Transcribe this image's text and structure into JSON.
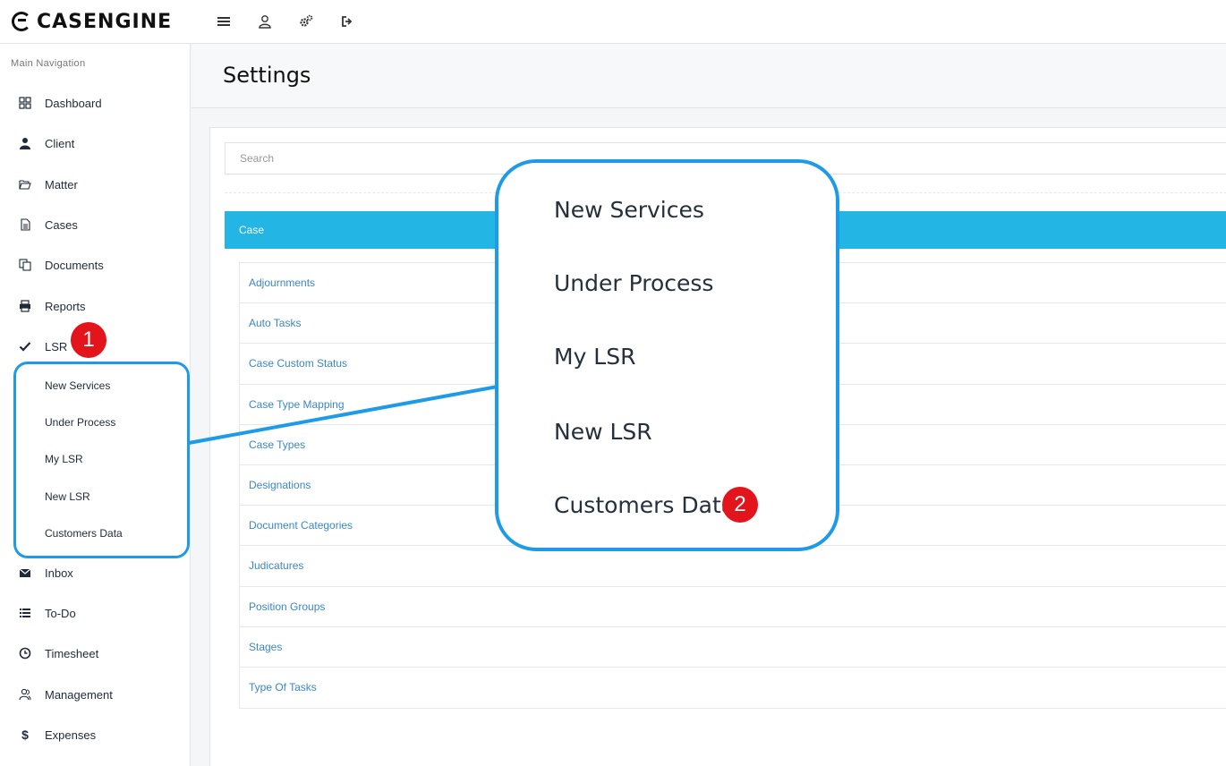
{
  "brand": {
    "name": "CASENGINE"
  },
  "topbar": {
    "icons": [
      {
        "name": "menu-icon"
      },
      {
        "name": "user-icon"
      },
      {
        "name": "settings-gears-icon"
      },
      {
        "name": "logout-icon"
      }
    ]
  },
  "sidebar": {
    "heading": "Main Navigation",
    "items": [
      {
        "label": "Dashboard",
        "icon": "grid-icon"
      },
      {
        "label": "Client",
        "icon": "person-icon"
      },
      {
        "label": "Matter",
        "icon": "folder-open-icon"
      },
      {
        "label": "Cases",
        "icon": "document-icon"
      },
      {
        "label": "Documents",
        "icon": "copy-icon"
      },
      {
        "label": "Reports",
        "icon": "printer-icon"
      },
      {
        "label": "LSR",
        "icon": "check-icon"
      },
      {
        "label": "Inbox",
        "icon": "envelope-icon"
      },
      {
        "label": "To-Do",
        "icon": "list-icon"
      },
      {
        "label": "Timesheet",
        "icon": "clock-icon"
      },
      {
        "label": "Management",
        "icon": "users-icon"
      },
      {
        "label": "Expenses",
        "icon": "dollar-icon"
      }
    ],
    "lsr_sub_items": [
      "New Services",
      "Under Process",
      "My LSR",
      "New LSR",
      "Customers Data"
    ]
  },
  "main": {
    "title": "Settings",
    "search_placeholder": "Search",
    "panel_title": "Case",
    "settings_links": [
      "Adjournments",
      "Auto Tasks",
      "Case Custom Status",
      "Case Type Mapping",
      "Case Types",
      "Designations",
      "Document Categories",
      "Judicatures",
      "Position Groups",
      "Stages",
      "Type Of Tasks"
    ]
  },
  "annotations": {
    "zoom_items": [
      "New Services",
      "Under Process",
      "My LSR",
      "New LSR",
      "Customers Data"
    ],
    "badge_1": "1",
    "badge_2": "2",
    "accent_color": "#1e9be8",
    "badge_color": "#e3141b",
    "panel_color": "#23b5e3"
  }
}
